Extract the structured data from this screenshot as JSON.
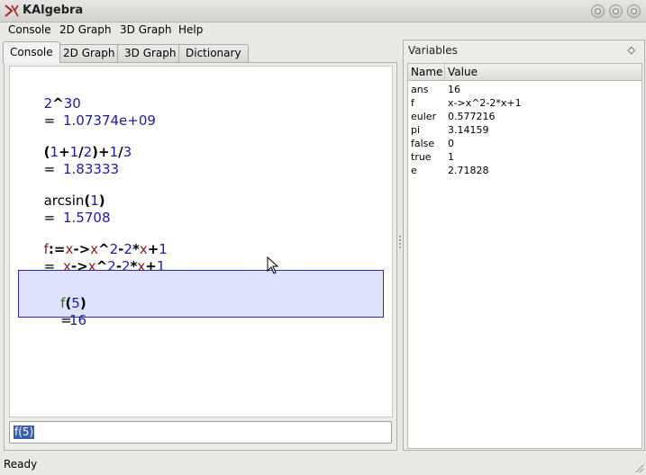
{
  "window": {
    "title": "KAlgebra"
  },
  "menubar": {
    "items": [
      {
        "label": "Console"
      },
      {
        "label": "2D Graph"
      },
      {
        "label": "3D Graph"
      },
      {
        "label": "Help"
      }
    ]
  },
  "tabs": [
    {
      "label": "Console",
      "active": true
    },
    {
      "label": "2D Graph",
      "active": false
    },
    {
      "label": "3D Graph",
      "active": false
    },
    {
      "label": "Dictionary",
      "active": false
    }
  ],
  "console": {
    "entries": [
      {
        "expression": "2^30",
        "result": "1.07374e+09"
      },
      {
        "expression": "(1+1/2)+1/3",
        "result": "1.83333"
      },
      {
        "expression": "arcsin(1)",
        "result": "1.5708"
      },
      {
        "expression": "f:=x->x^2-2*x+1",
        "result": "x->x^2-2*x+1"
      },
      {
        "expression": "f(5)",
        "result": "16",
        "selected": true
      }
    ],
    "result_prefix": "=",
    "input_value": "f(5)"
  },
  "variables": {
    "title": "Variables",
    "columns": [
      "Name",
      "Value"
    ],
    "rows": [
      {
        "name": "ans",
        "value": "16"
      },
      {
        "name": "f",
        "value": "x->x^2-2*x+1"
      },
      {
        "name": "euler",
        "value": "0.577216"
      },
      {
        "name": "pi",
        "value": "3.14159"
      },
      {
        "name": "false",
        "value": "0"
      },
      {
        "name": "true",
        "value": "1"
      },
      {
        "name": "e",
        "value": "2.71828"
      }
    ]
  },
  "status": {
    "text": "Ready"
  },
  "colors": {
    "number": "#1a1aa8",
    "variable": "#8b1a1a",
    "definition": "#1a7a1a",
    "selection_bg": "#dfe2fb",
    "selection_border": "#2a2ab4"
  }
}
